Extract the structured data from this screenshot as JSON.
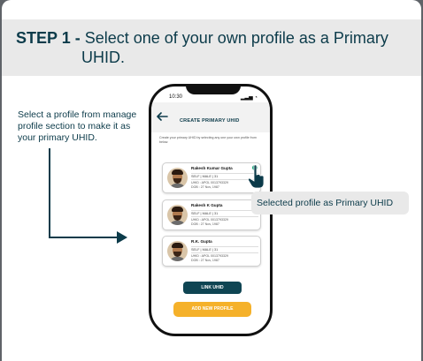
{
  "step": {
    "prefix": "STEP 1 -",
    "title_line1": "Select one of your own profile as a Primary",
    "title_line2": "UHID."
  },
  "instruction": "Select a profile from manage profile section to make it as your primary UHID.",
  "tooltip": "Selected profile as Primary UHID",
  "phone": {
    "time": "10:30",
    "status": "▂▃▅ ◔",
    "header_title": "CREATE PRIMARY UHID",
    "description": "Create your primary UHID by selecting any one your own profile from below.",
    "profiles": [
      {
        "name": "Rakesh Kumar Gupta",
        "meta": "SELF | MALE | 31",
        "uhid": "UHID : APOL 0013793329",
        "dob": "DOB : 27 Nov, 1987",
        "selected": true
      },
      {
        "name": "Rakesh K Gupta",
        "meta": "SELF | MALE | 31",
        "uhid": "UHID : APOL 0013793329",
        "dob": "DOB : 27 Nov, 1987",
        "selected": false
      },
      {
        "name": "R.K. Gupta",
        "meta": "SELF | MALE | 31",
        "uhid": "UHID : APOL 0013793329",
        "dob": "DOB : 27 Nov, 1987",
        "selected": false
      }
    ],
    "link_button": "LINK UHID",
    "add_button": "ADD NEW PROFILE"
  },
  "colors": {
    "primary": "#0c3b4a",
    "accent": "#f5b12a",
    "selected": "#1aa37a",
    "banner": "#e9e9e9"
  }
}
